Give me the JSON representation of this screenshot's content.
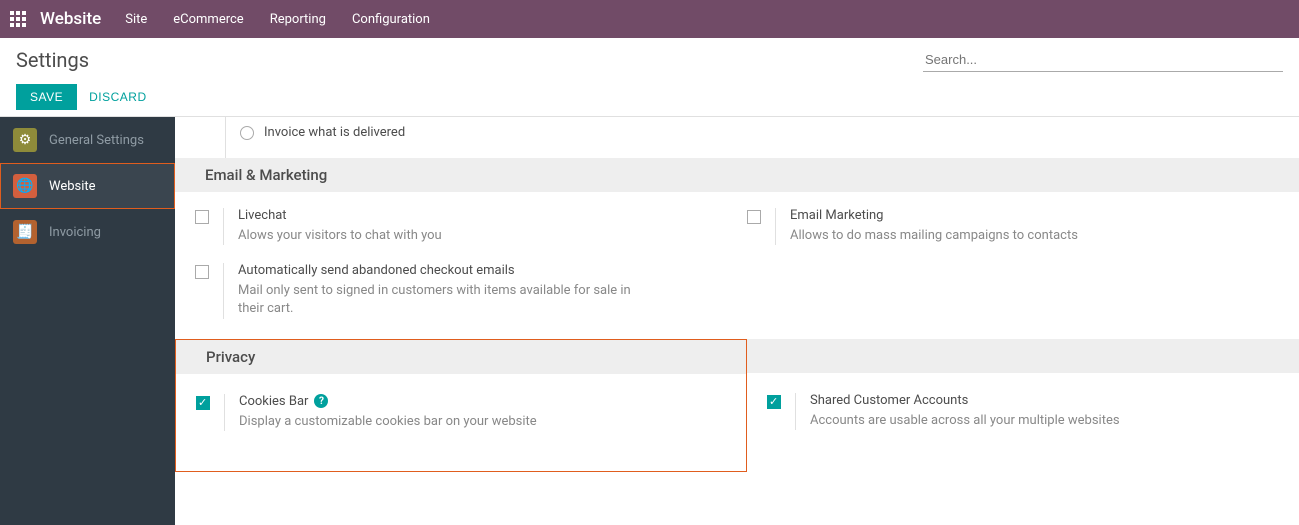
{
  "topnav": {
    "brand": "Website",
    "menu": [
      "Site",
      "eCommerce",
      "Reporting",
      "Configuration"
    ]
  },
  "page_title": "Settings",
  "search_placeholder": "Search...",
  "buttons": {
    "save": "SAVE",
    "discard": "DISCARD"
  },
  "sidebar": {
    "items": [
      {
        "label": "General Settings"
      },
      {
        "label": "Website"
      },
      {
        "label": "Invoicing"
      }
    ]
  },
  "radio": {
    "label": "Invoice what is delivered"
  },
  "sections": {
    "email": {
      "title": "Email & Marketing",
      "items": [
        {
          "title": "Livechat",
          "desc": "Alows your visitors to chat with you"
        },
        {
          "title": "Email Marketing",
          "desc": "Allows to do mass mailing campaigns to contacts"
        },
        {
          "title": "Automatically send abandoned checkout emails",
          "desc": "Mail only sent to signed in customers with items available for sale in their cart."
        }
      ]
    },
    "privacy": {
      "title": "Privacy",
      "items": [
        {
          "title": "Cookies Bar",
          "desc": "Display a customizable cookies bar on your website"
        },
        {
          "title": "Shared Customer Accounts",
          "desc": "Accounts are usable across all your multiple websites"
        }
      ]
    }
  }
}
